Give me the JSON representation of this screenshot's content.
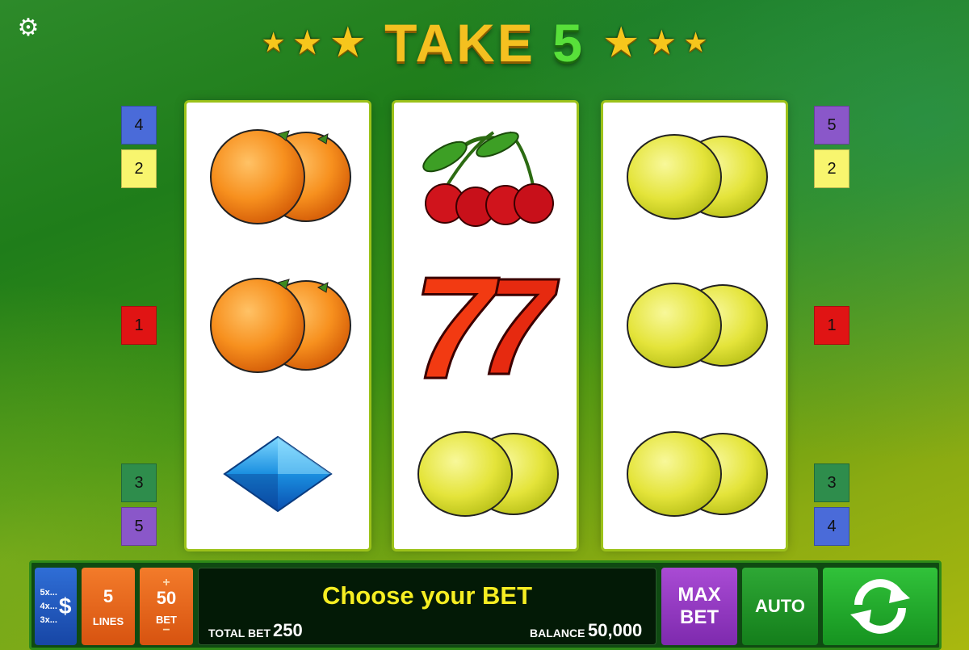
{
  "header": {
    "title_main": "TAKE",
    "title_number": "5",
    "settings_icon": "gear-icon"
  },
  "reels": [
    {
      "symbols": [
        "orange",
        "orange",
        "diamond"
      ]
    },
    {
      "symbols": [
        "cherry",
        "seven",
        "lemon"
      ]
    },
    {
      "symbols": [
        "lemon",
        "lemon",
        "lemon"
      ]
    }
  ],
  "paylines_left": [
    {
      "label": "4",
      "color": "#4a6bd9"
    },
    {
      "label": "2",
      "color": "#f8f56e"
    },
    {
      "label": "1",
      "color": "#e01414"
    },
    {
      "label": "3",
      "color": "#2e8d4c"
    },
    {
      "label": "5",
      "color": "#8a57c9"
    }
  ],
  "paylines_right": [
    {
      "label": "5",
      "color": "#8a57c9"
    },
    {
      "label": "2",
      "color": "#f8f56e"
    },
    {
      "label": "1",
      "color": "#e01414"
    },
    {
      "label": "3",
      "color": "#2e8d4c"
    },
    {
      "label": "4",
      "color": "#4a6bd9"
    }
  ],
  "controls": {
    "paytable": {
      "rows": [
        "5x...",
        "4x...",
        "3x..."
      ],
      "symbol": "$"
    },
    "lines": {
      "value": "5",
      "label": "LINES"
    },
    "bet": {
      "value": "50",
      "label": "BET",
      "plus": "+",
      "minus": "−"
    },
    "message": "Choose your BET",
    "total_bet_label": "TOTAL BET",
    "total_bet_value": "250",
    "balance_label": "BALANCE",
    "balance_value": "50,000",
    "max_bet_line1": "MAX",
    "max_bet_line2": "BET",
    "auto_label": "AUTO",
    "spin_icon": "spin-arrows-icon"
  },
  "colors": {
    "title_gold": "#f4c020",
    "title_green": "#58e03a",
    "message_yellow": "#f6ee22"
  }
}
